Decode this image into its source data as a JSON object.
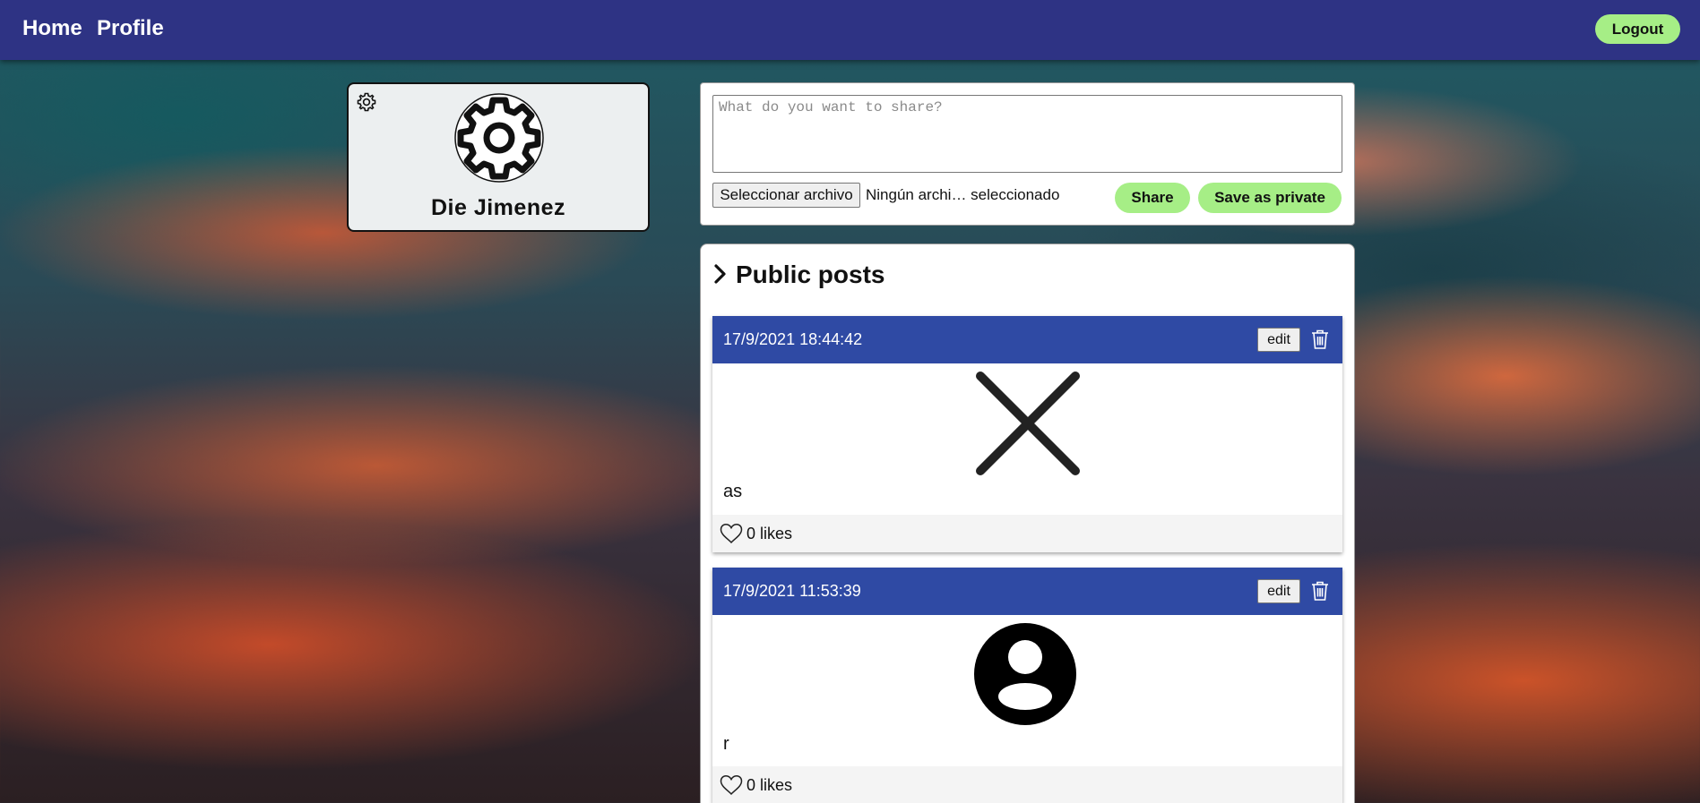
{
  "nav": {
    "home_label": "Home",
    "profile_label": "Profile",
    "logout_label": "Logout"
  },
  "profile": {
    "name": "Die Jimenez",
    "avatar_icon": "gear-icon",
    "settings_icon": "gear-icon"
  },
  "composer": {
    "placeholder": "What do you want to share?",
    "file_button_label": "Seleccionar archivo",
    "file_status": "Ningún archi… seleccionado",
    "share_label": "Share",
    "private_label": "Save as private"
  },
  "posts_section": {
    "title": "Public posts",
    "icon": "chevron-right-icon"
  },
  "posts": [
    {
      "timestamp": "17/9/2021 18:44:42",
      "edit_label": "edit",
      "image_icon": "close-x-icon",
      "text": "as",
      "likes": "0 likes"
    },
    {
      "timestamp": "17/9/2021 11:53:39",
      "edit_label": "edit",
      "image_icon": "user-avatar-icon",
      "text": "r",
      "likes": "0 likes"
    }
  ],
  "colors": {
    "navbar": "#2e3384",
    "accent_button": "#a6ee86",
    "post_header": "#2f4aa4"
  }
}
